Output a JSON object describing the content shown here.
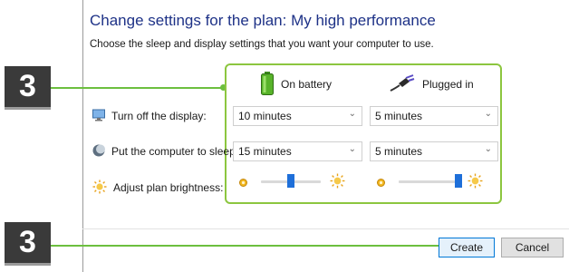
{
  "header": {
    "title": "Change settings for the plan: My high performance",
    "subtitle": "Choose the sleep and display settings that you want your computer to use."
  },
  "callouts": [
    "3",
    "3"
  ],
  "columns": {
    "battery": "On battery",
    "plugged": "Plugged in"
  },
  "rows": {
    "display": {
      "label": "Turn off the display:",
      "battery_value": "10 minutes",
      "plugged_value": "5 minutes"
    },
    "sleep": {
      "label": "Put the computer to sleep:",
      "battery_value": "15 minutes",
      "plugged_value": "5 minutes"
    },
    "brightness": {
      "label": "Adjust plan brightness:",
      "battery_level": 0.5,
      "plugged_level": 1.0
    }
  },
  "buttons": {
    "create": "Create",
    "cancel": "Cancel"
  },
  "colors": {
    "title": "#1e3287",
    "callout_line": "#6cbf3f",
    "frame": "#8cc63f",
    "slider_thumb": "#1e6fd9"
  },
  "icons": {
    "battery": "battery-icon",
    "plugged": "power-plug-icon",
    "display": "monitor-icon",
    "sleep": "moon-icon",
    "brightness": "sun-icon"
  }
}
